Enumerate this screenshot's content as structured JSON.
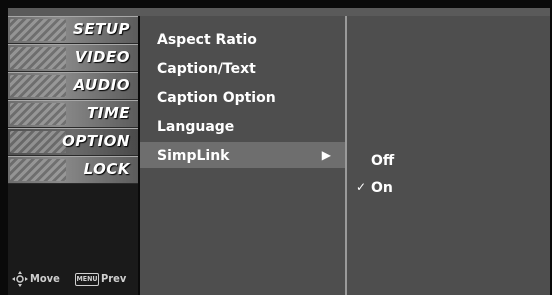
{
  "sidebar": {
    "items": [
      {
        "label": "SETUP"
      },
      {
        "label": "VIDEO"
      },
      {
        "label": "AUDIO"
      },
      {
        "label": "TIME"
      },
      {
        "label": "OPTION"
      },
      {
        "label": "LOCK"
      }
    ],
    "footer": {
      "move_label": "Move",
      "menu_key": "MENU",
      "prev_label": "Prev"
    }
  },
  "menu": {
    "items": [
      {
        "label": "Aspect Ratio"
      },
      {
        "label": "Caption/Text"
      },
      {
        "label": "Caption Option"
      },
      {
        "label": "Language"
      },
      {
        "label": "SimpLink",
        "arrow": "▶"
      }
    ]
  },
  "submenu": {
    "options": [
      {
        "label": "Off",
        "check": ""
      },
      {
        "label": "On",
        "check": "✓"
      }
    ]
  },
  "active": {
    "sidebar": "OPTION",
    "menu": "SimpLink",
    "option": "On"
  }
}
